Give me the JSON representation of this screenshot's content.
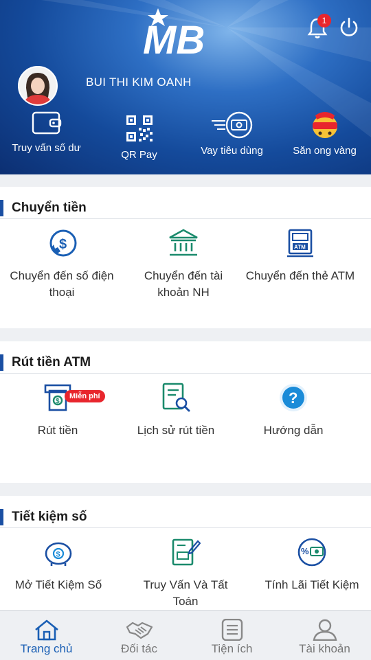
{
  "header": {
    "brand": "MB",
    "notification_count": "1",
    "user_name": "BUI THI KIM OANH",
    "quick_actions": [
      {
        "label": "Truy vấn số dư",
        "icon": "wallet-icon"
      },
      {
        "label": "QR Pay",
        "icon": "qr-code-icon"
      },
      {
        "label": "Vay tiêu dùng",
        "icon": "cash-fast-icon"
      },
      {
        "label": "Săn ong vàng",
        "icon": "golden-bee-icon"
      }
    ]
  },
  "sections": [
    {
      "title": "Chuyển tiền",
      "items": [
        {
          "label": "Chuyển đến số điện thoại",
          "icon": "phone-money-icon"
        },
        {
          "label": "Chuyển đến tài khoản NH",
          "icon": "bank-icon"
        },
        {
          "label": "Chuyển đến thẻ ATM",
          "icon": "atm-card-icon"
        }
      ]
    },
    {
      "title": "Rút tiền ATM",
      "items": [
        {
          "label": "Rút tiền",
          "icon": "atm-withdraw-icon",
          "badge": "Miễn phí"
        },
        {
          "label": "Lịch sử rút tiền",
          "icon": "history-search-icon"
        },
        {
          "label": "Hướng dẫn",
          "icon": "help-icon"
        }
      ]
    },
    {
      "title": "Tiết kiệm số",
      "items": [
        {
          "label": "Mở Tiết Kiệm Số",
          "icon": "piggy-bank-icon"
        },
        {
          "label": "Truy Vấn Và Tất Toán",
          "icon": "document-edit-icon"
        },
        {
          "label": "Tính Lãi Tiết Kiệm",
          "icon": "interest-icon"
        }
      ]
    }
  ],
  "bottom_nav": [
    {
      "label": "Trang chủ",
      "icon": "home-icon",
      "active": true
    },
    {
      "label": "Đối tác",
      "icon": "handshake-icon",
      "active": false
    },
    {
      "label": "Tiện ích",
      "icon": "utilities-icon",
      "active": false
    },
    {
      "label": "Tài khoản",
      "icon": "account-icon",
      "active": false
    }
  ],
  "colors": {
    "primary": "#1a4fa3",
    "accent_red": "#e8262d",
    "active_nav": "#1a5fb4"
  }
}
